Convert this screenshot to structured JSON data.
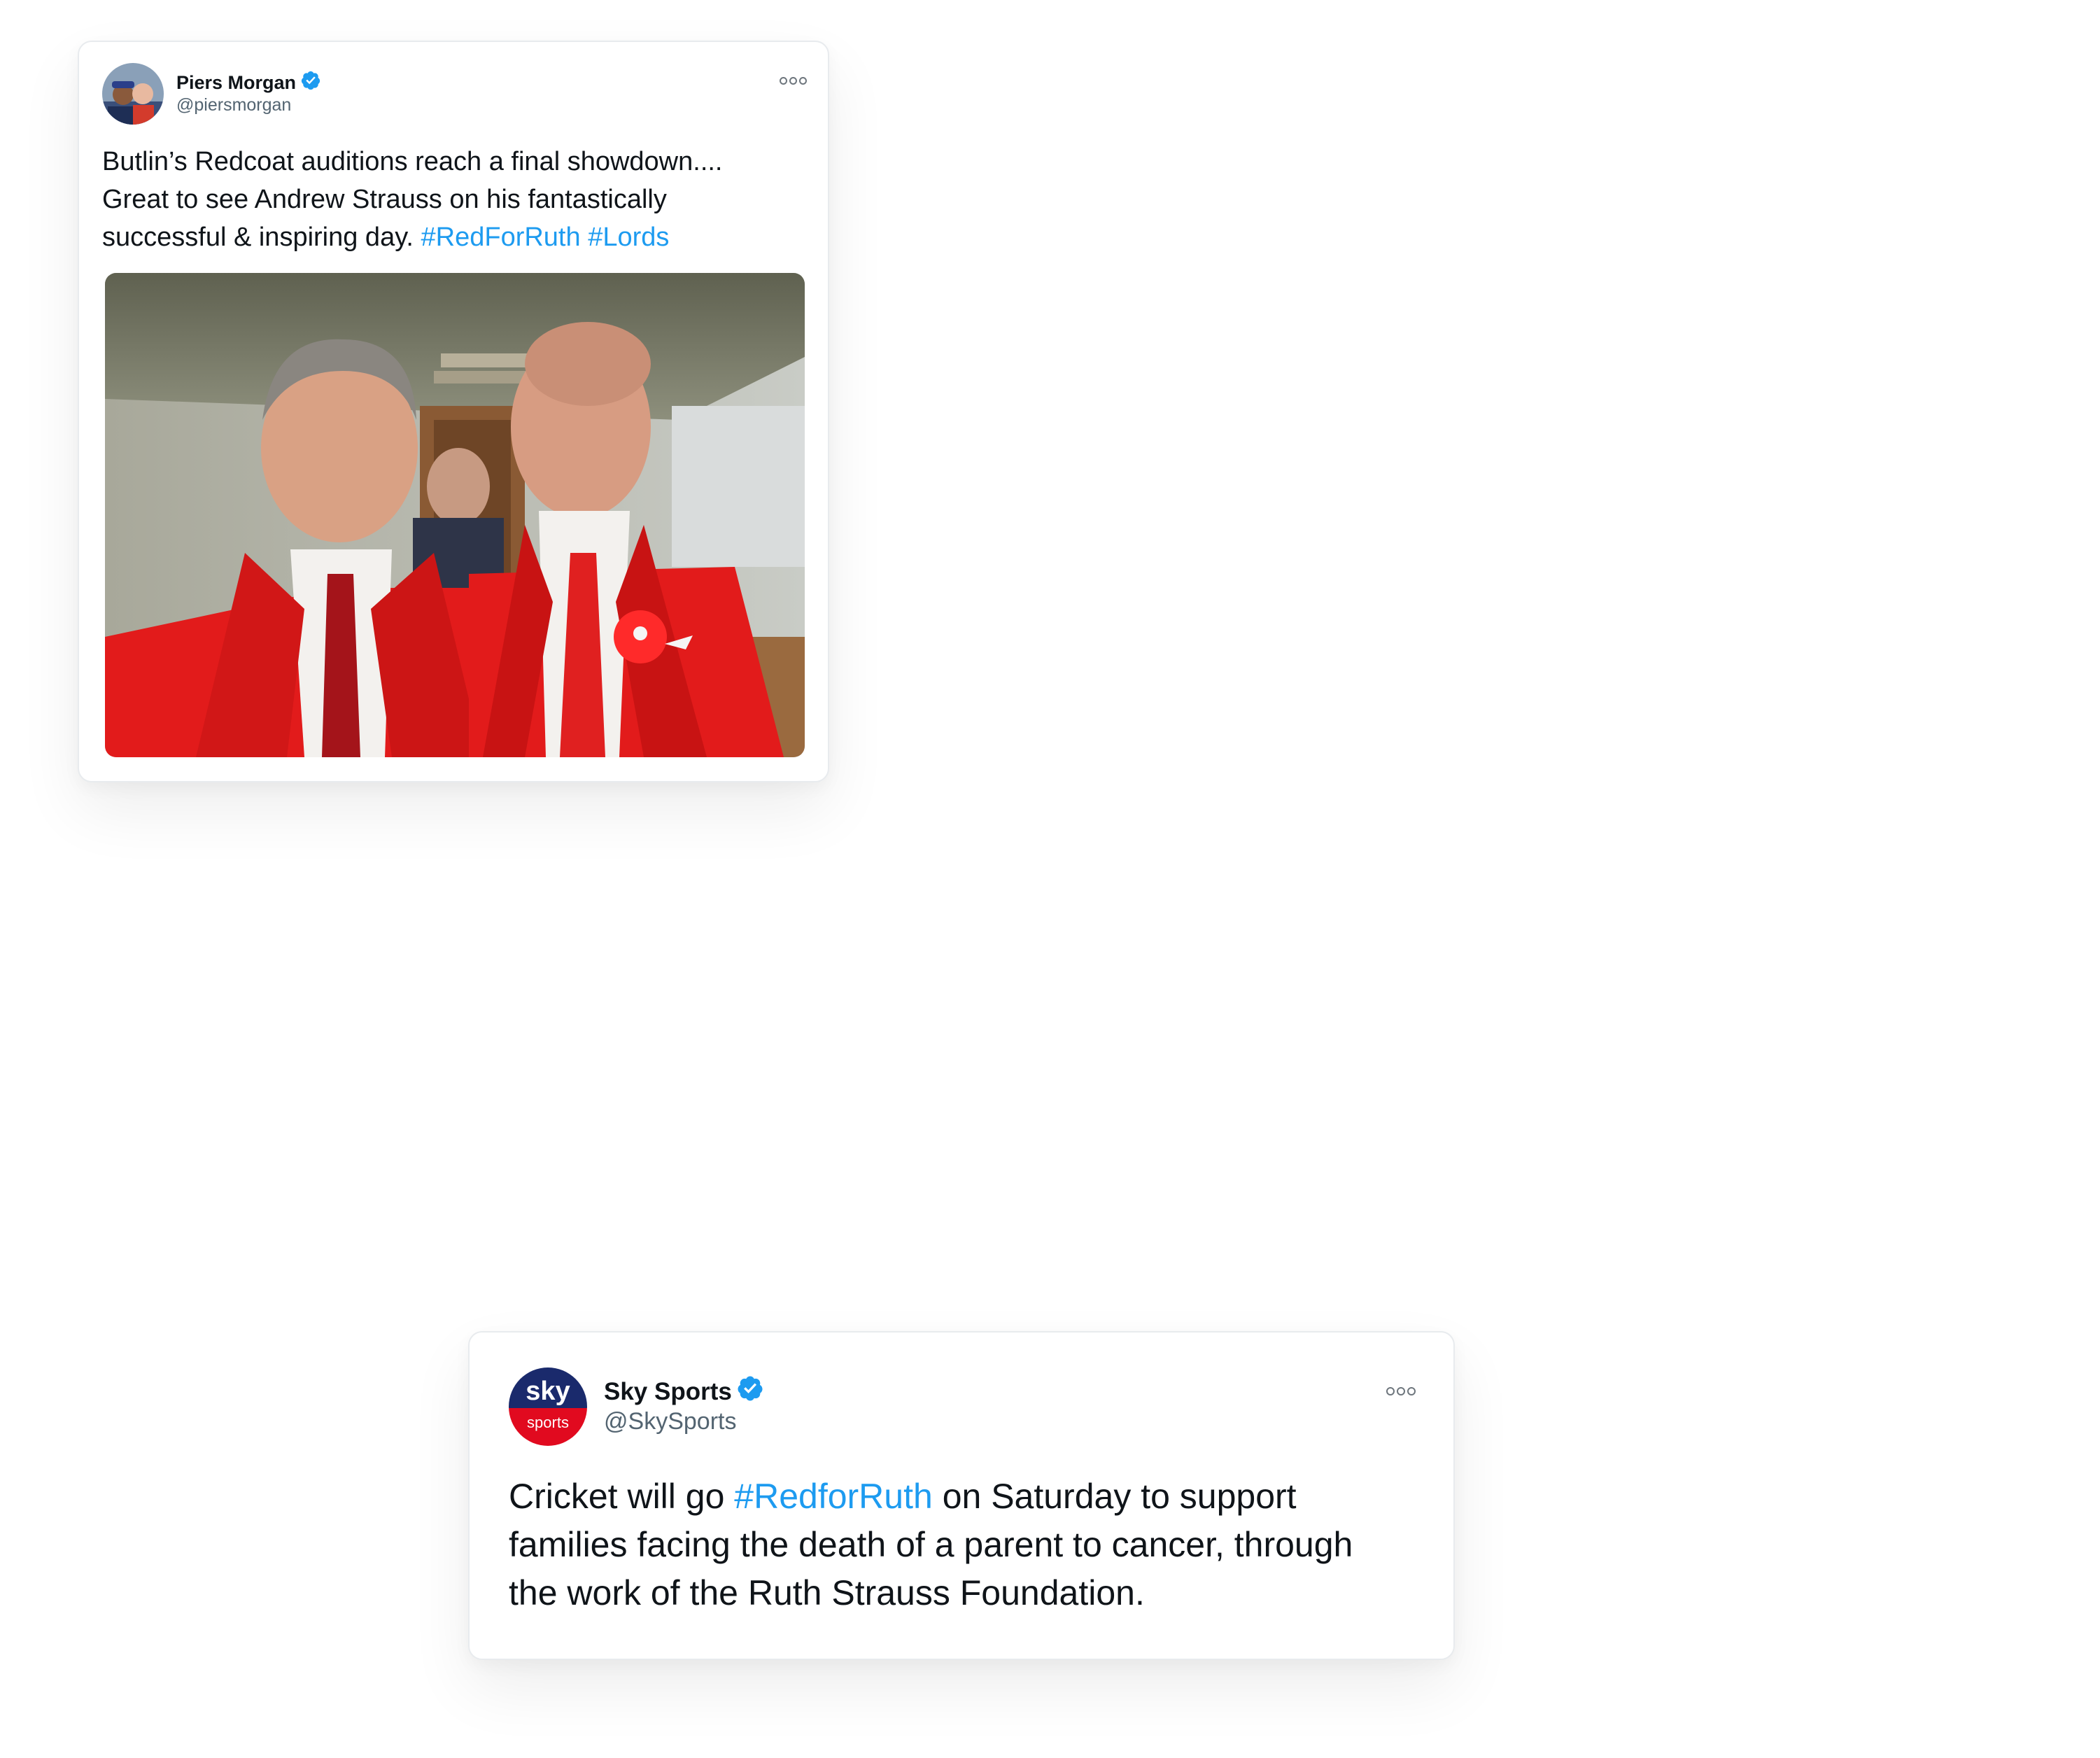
{
  "tweets": [
    {
      "name": "Piers Morgan",
      "handle": "@piersmorgan",
      "verified": true,
      "text_lines": [
        "Butlin’s Redcoat auditions reach a final showdown....",
        "Great to see Andrew Strauss on his fantastically",
        "successful & inspiring day."
      ],
      "hashtags": [
        "#RedForRuth",
        "#Lords"
      ],
      "has_photo": true
    },
    {
      "name": "Sky Sports",
      "handle": "@SkySports",
      "verified": true,
      "avatar_text": {
        "top": "sky",
        "bottom": "sports"
      },
      "text_before": "Cricket will go ",
      "hashtag": "#RedforRuth",
      "text_after_lines": [
        " on Saturday to support",
        "families facing the death of a parent to cancer, through",
        "the work of the Ruth Strauss Foundation."
      ]
    }
  ],
  "colors": {
    "link": "#1d9bf0",
    "verified": "#1d9bf0",
    "text": "#0f1419",
    "secondary": "#536471",
    "sky_navy": "#1a2a6c",
    "sky_red": "#e10a1f",
    "jacket_red": "#e21b1b"
  },
  "icons": {
    "verified": "verified-badge-icon",
    "more": "more-options-icon"
  }
}
